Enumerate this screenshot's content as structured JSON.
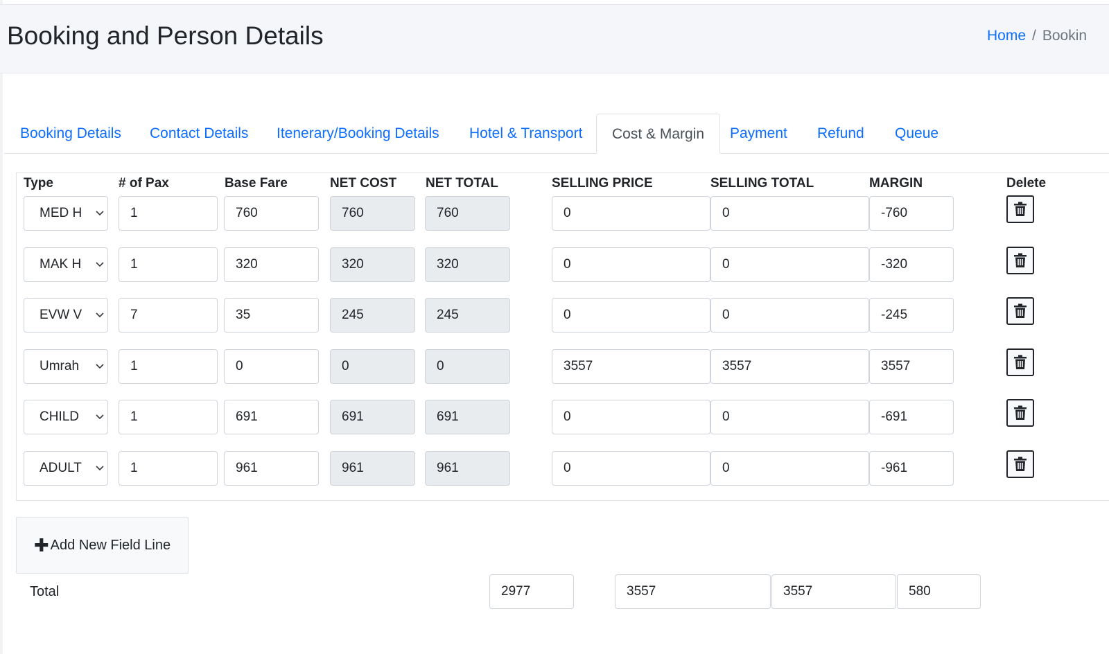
{
  "header": {
    "title": "Booking and Person Details",
    "breadcrumb": {
      "home": "Home",
      "separator": "/",
      "current": "Bookin"
    }
  },
  "tabs": [
    {
      "label": "Booking Details"
    },
    {
      "label": "Contact Details"
    },
    {
      "label": "Itenerary/Booking Details"
    },
    {
      "label": "Hotel & Transport"
    },
    {
      "label": "Cost & Margin",
      "active": true
    },
    {
      "label": "Payment"
    },
    {
      "label": "Refund"
    },
    {
      "label": "Queue"
    }
  ],
  "table": {
    "columns": {
      "type": "Type",
      "pax": "# of Pax",
      "base_fare": "Base Fare",
      "net_cost": "NET COST",
      "net_total": "NET TOTAL",
      "selling_price": "SELLING PRICE",
      "selling_total": "SELLING TOTAL",
      "margin": "MARGIN",
      "delete": "Delete"
    },
    "rows": [
      {
        "type": "MED H",
        "pax": "1",
        "base_fare": "760",
        "net_cost": "760",
        "net_total": "760",
        "selling_price": "0",
        "selling_total": "0",
        "margin": "-760"
      },
      {
        "type": "MAK H",
        "pax": "1",
        "base_fare": "320",
        "net_cost": "320",
        "net_total": "320",
        "selling_price": "0",
        "selling_total": "0",
        "margin": "-320"
      },
      {
        "type": "EVW Vi",
        "pax": "7",
        "base_fare": "35",
        "net_cost": "245",
        "net_total": "245",
        "selling_price": "0",
        "selling_total": "0",
        "margin": "-245"
      },
      {
        "type": "Umrah",
        "pax": "1",
        "base_fare": "0",
        "net_cost": "0",
        "net_total": "0",
        "selling_price": "3557",
        "selling_total": "3557",
        "margin": "3557"
      },
      {
        "type": "CHILD",
        "pax": "1",
        "base_fare": "691",
        "net_cost": "691",
        "net_total": "691",
        "selling_price": "0",
        "selling_total": "0",
        "margin": "-691"
      },
      {
        "type": "ADULT",
        "pax": "1",
        "base_fare": "961",
        "net_cost": "961",
        "net_total": "961",
        "selling_price": "0",
        "selling_total": "0",
        "margin": "-961"
      }
    ]
  },
  "add_line": {
    "icon": "plus-icon",
    "label": "Add New Field Line"
  },
  "totals": {
    "label": "Total",
    "net_total": "2977",
    "selling_price": "3557",
    "selling_total": "3557",
    "margin": "580"
  },
  "icons": {
    "delete": "trash-icon",
    "select": "chevron-down-icon"
  },
  "colors": {
    "link": "#0d6efd",
    "readonly_bg": "#e9ecef",
    "header_bg": "#f4f6f9"
  }
}
